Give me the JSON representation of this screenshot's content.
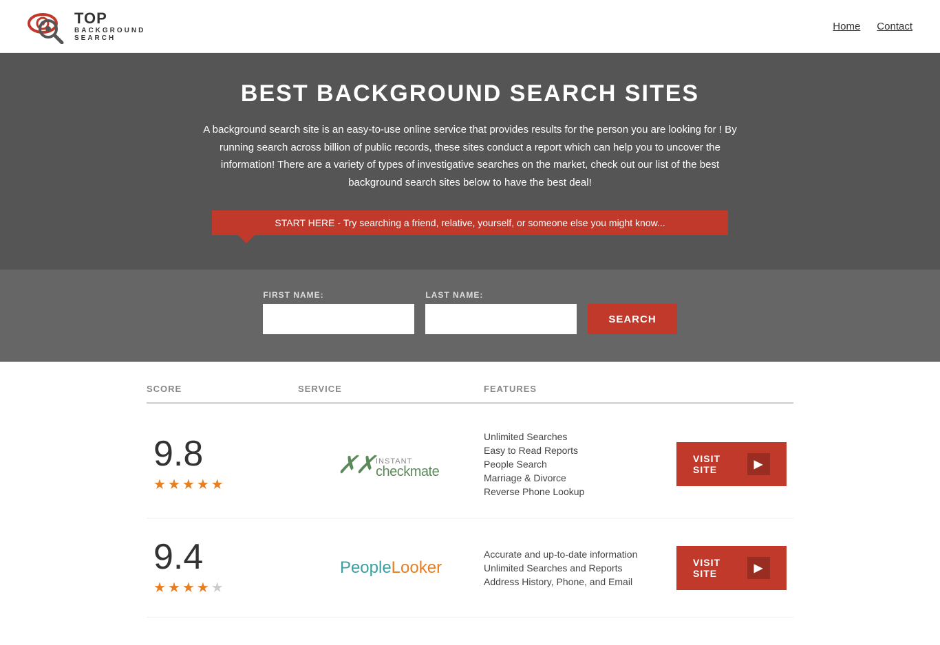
{
  "header": {
    "logo_top": "TOP",
    "logo_bottom": "BACKGROUND\nSEARCH",
    "nav": [
      {
        "label": "Home",
        "href": "#"
      },
      {
        "label": "Contact",
        "href": "#"
      }
    ]
  },
  "hero": {
    "title": "BEST BACKGROUND SEARCH SITES",
    "description": "A background search site is an easy-to-use online service that provides results  for the person you are looking for ! By  running  search across billion of public records, these sites conduct  a report which can help you to uncover the information! There are a variety of types of investigative searches on the market, check out our  list of the best background search sites below to have the best deal!",
    "callout": "START HERE - Try searching a friend, relative, yourself, or someone else you might know...",
    "form": {
      "first_name_label": "FIRST NAME:",
      "last_name_label": "LAST NAME:",
      "search_button": "SEARCH"
    }
  },
  "table": {
    "headers": {
      "score": "SCORE",
      "service": "SERVICE",
      "features": "FEATURES",
      "action": ""
    },
    "rows": [
      {
        "score": "9.8",
        "stars": 4.5,
        "service_name": "Instant Checkmate",
        "features": [
          "Unlimited Searches",
          "Easy to Read Reports",
          "People Search",
          "Marriage & Divorce",
          "Reverse Phone Lookup"
        ],
        "visit_label": "VISIT SITE"
      },
      {
        "score": "9.4",
        "stars": 4,
        "service_name": "PeopleLooker",
        "features": [
          "Accurate and up-to-date information",
          "Unlimited Searches and Reports",
          "Address History, Phone, and Email"
        ],
        "visit_label": "VISIT SITE"
      }
    ]
  }
}
